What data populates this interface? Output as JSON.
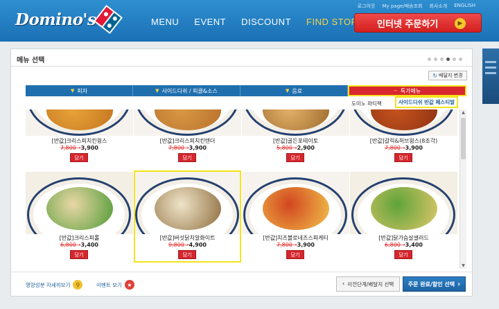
{
  "header": {
    "logo_text": "Domino's",
    "nav": [
      "MENU",
      "EVENT",
      "DISCOUNT",
      "FIND STORE"
    ],
    "active_nav": "FIND STORE",
    "util_links": [
      "로그아웃",
      "My page/배송조회",
      "회사소개",
      "ENGLISH"
    ],
    "order_button": "인터넷 주문하기"
  },
  "panel": {
    "title": "메뉴 선택",
    "address_button": "배달지 변경",
    "carousel_dots": 6,
    "carousel_active": 3
  },
  "categories": [
    "피자",
    "사이드디쉬 / 피클&소스",
    "음료",
    "특가메뉴"
  ],
  "active_category": "특가메뉴",
  "subtabs": [
    "도미노 파티팩",
    "사이드디쉬 반값 페스티발"
  ],
  "active_subtab": "사이드디쉬 반값 페스티발",
  "add_label": "담기",
  "products": [
    {
      "name": "[반값]크리스피치킨윙스",
      "old_price": "7,800",
      "new_price": "3,900",
      "dish": "wings"
    },
    {
      "name": "[반값]크리스피치킨텐더",
      "old_price": "7,800",
      "new_price": "3,900",
      "dish": "tenders"
    },
    {
      "name": "[반값]골든포테이토",
      "old_price": "5,800",
      "new_price": "2,900",
      "dish": "potato"
    },
    {
      "name": "[반값]갈릭&허브윙스(8조각)",
      "old_price": "7,800",
      "new_price": "3,900",
      "dish": "garlic"
    },
    {
      "name": "[반값]크리스피롤",
      "old_price": "6,800",
      "new_price": "3,400",
      "dish": "roll"
    },
    {
      "name": "[반값]버섯닭치알화이트",
      "old_price": "9,800",
      "new_price": "4,900",
      "dish": "pasta",
      "highlighted": true
    },
    {
      "name": "[반값]치즈볼로네즈스파게티",
      "old_price": "7,800",
      "new_price": "3,900",
      "dish": "bolognese"
    },
    {
      "name": "[반값]닭가슴살샐러드",
      "old_price": "6,800",
      "new_price": "3,400",
      "dish": "salad"
    }
  ],
  "footer": {
    "nutrition_link": "영양성분 자세히보기",
    "event_link": "이벤트 보기",
    "prev_button": "이전단계/배달지 선택",
    "next_button": "주문 완료/할인 선택"
  },
  "colors": {
    "brand_blue": "#1f6fae",
    "brand_red": "#d9272e",
    "highlight_yellow": "#f4e31c",
    "price_red": "#e03030"
  }
}
